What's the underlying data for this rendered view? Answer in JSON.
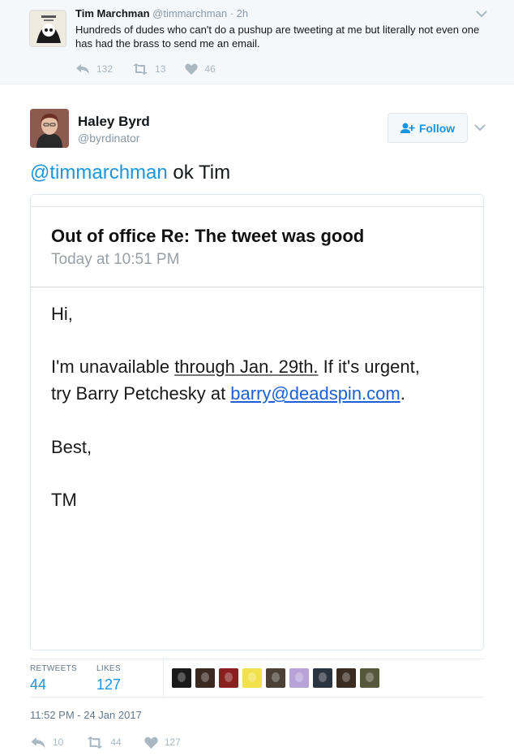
{
  "parent_tweet": {
    "name": "Tim Marchman",
    "handle": "@timmarchman",
    "time": "· 2h",
    "text": "Hundreds of dudes who can't do a pushup are tweeting at me but literally not even one has had the brass to send me an email.",
    "replies": "132",
    "retweets": "13",
    "likes": "46",
    "reply_icon": "reply-icon",
    "retweet_icon": "retweet-icon",
    "like_icon": "heart-icon"
  },
  "tweet": {
    "name": "Haley Byrd",
    "handle": "@byrdinator",
    "follow_label": "Follow",
    "mention": "@timmarchman",
    "text": " ok Tim",
    "timestamp": "11:52 PM - 24 Jan 2017",
    "stats": {
      "retweets_label": "RETWEETS",
      "retweets_value": "44",
      "likes_label": "LIKES",
      "likes_value": "127"
    },
    "actions": {
      "replies": "10",
      "retweets": "44",
      "likes": "127"
    }
  },
  "email": {
    "subject": "Out of office Re: The tweet was good",
    "date": "Today at 10:51 PM",
    "greeting": "Hi,",
    "line1_a": "I'm unavailable ",
    "line1_b": "through Jan. 29th.",
    "line1_c": " If it's urgent,",
    "line2_a": "try Barry Petchesky at ",
    "line2_link": "barry@deadspin.com",
    "line2_c": ".",
    "closing": "Best,",
    "signature": "TM"
  },
  "likers": [
    "#1a1a1a",
    "#3b2a22",
    "#8a1f1f",
    "#f2e14a",
    "#4a4036",
    "#b8a3d8",
    "#2a3340",
    "#3a2c20",
    "#55583a"
  ],
  "colors": {
    "accent": "#1b95e0",
    "muted": "#8899a6",
    "parent_bg": "#f5f8fa",
    "link": "#1d5fd6"
  }
}
